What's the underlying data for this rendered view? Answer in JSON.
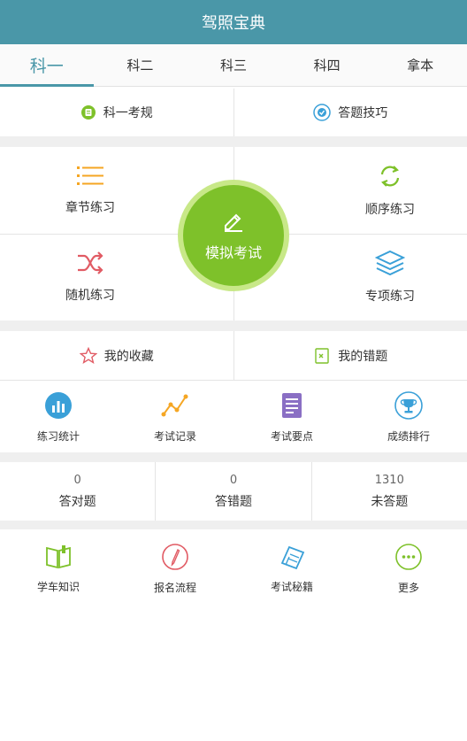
{
  "app": {
    "title": "驾照宝典"
  },
  "tabs": [
    {
      "label": "科一",
      "active": true
    },
    {
      "label": "科二"
    },
    {
      "label": "科三"
    },
    {
      "label": "科四"
    },
    {
      "label": "拿本"
    }
  ],
  "quick_links": [
    {
      "label": "科一考规",
      "icon": "rules-icon"
    },
    {
      "label": "答题技巧",
      "icon": "tips-icon"
    }
  ],
  "practice": {
    "chapter": "章节练习",
    "sequential": "顺序练习",
    "random": "随机练习",
    "special": "专项练习",
    "exam": "模拟考试"
  },
  "my_items": [
    {
      "label": "我的收藏",
      "icon": "star-icon"
    },
    {
      "label": "我的错题",
      "icon": "wrong-book-icon"
    }
  ],
  "tools": [
    {
      "label": "练习统计",
      "icon": "bar-chart-icon"
    },
    {
      "label": "考试记录",
      "icon": "line-chart-icon"
    },
    {
      "label": "考试要点",
      "icon": "document-icon"
    },
    {
      "label": "成绩排行",
      "icon": "trophy-icon"
    }
  ],
  "stats": [
    {
      "value": "0",
      "label": "答对题"
    },
    {
      "value": "0",
      "label": "答错题"
    },
    {
      "value": "1310",
      "label": "未答题"
    }
  ],
  "more_links": [
    {
      "label": "学车知识",
      "icon": "book-icon"
    },
    {
      "label": "报名流程",
      "icon": "pen-circle-icon"
    },
    {
      "label": "考试秘籍",
      "icon": "notebook-icon"
    },
    {
      "label": "更多",
      "icon": "more-icon"
    }
  ],
  "colors": {
    "header": "#4a97a8",
    "accent_green": "#7ec12a",
    "orange": "#f5a623",
    "red": "#e15b64",
    "blue": "#3aa0d8",
    "purple": "#8a6fc4"
  }
}
